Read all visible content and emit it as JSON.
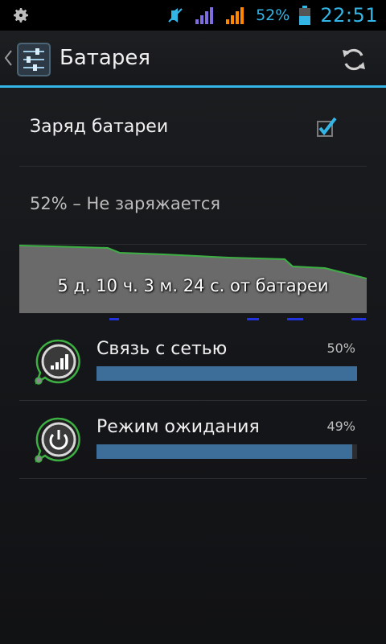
{
  "status_bar": {
    "battery_percent": "52%",
    "time": "22:51",
    "icons": [
      "settings-icon",
      "mute-icon",
      "signal-icon",
      "signal-icon",
      "battery-icon"
    ]
  },
  "action_bar": {
    "title": "Батарея",
    "icons": [
      "back-chevron-icon",
      "settings-app-icon",
      "refresh-icon"
    ]
  },
  "charge_setting": {
    "label": "Заряд батареи",
    "checked": true
  },
  "battery_status": {
    "text": "52% – Не заряжается"
  },
  "graph": {
    "time_on_battery": "5 д. 10 ч. 3 м. 24 с. от батареи"
  },
  "usage": [
    {
      "label": "Связь с сетью",
      "percent": "50%",
      "fraction": 0.5,
      "icon": "cell-signal-icon"
    },
    {
      "label": "Режим ожидания",
      "percent": "49%",
      "fraction": 0.49,
      "icon": "power-icon"
    }
  ],
  "colors": {
    "accent": "#33b5e5",
    "bar": "#3d6e99",
    "graph_line": "#3cb043",
    "graph_fill": "#6a6a6a",
    "signal_orange": "#ff8800",
    "signal_purple": "#7e6ce0"
  }
}
